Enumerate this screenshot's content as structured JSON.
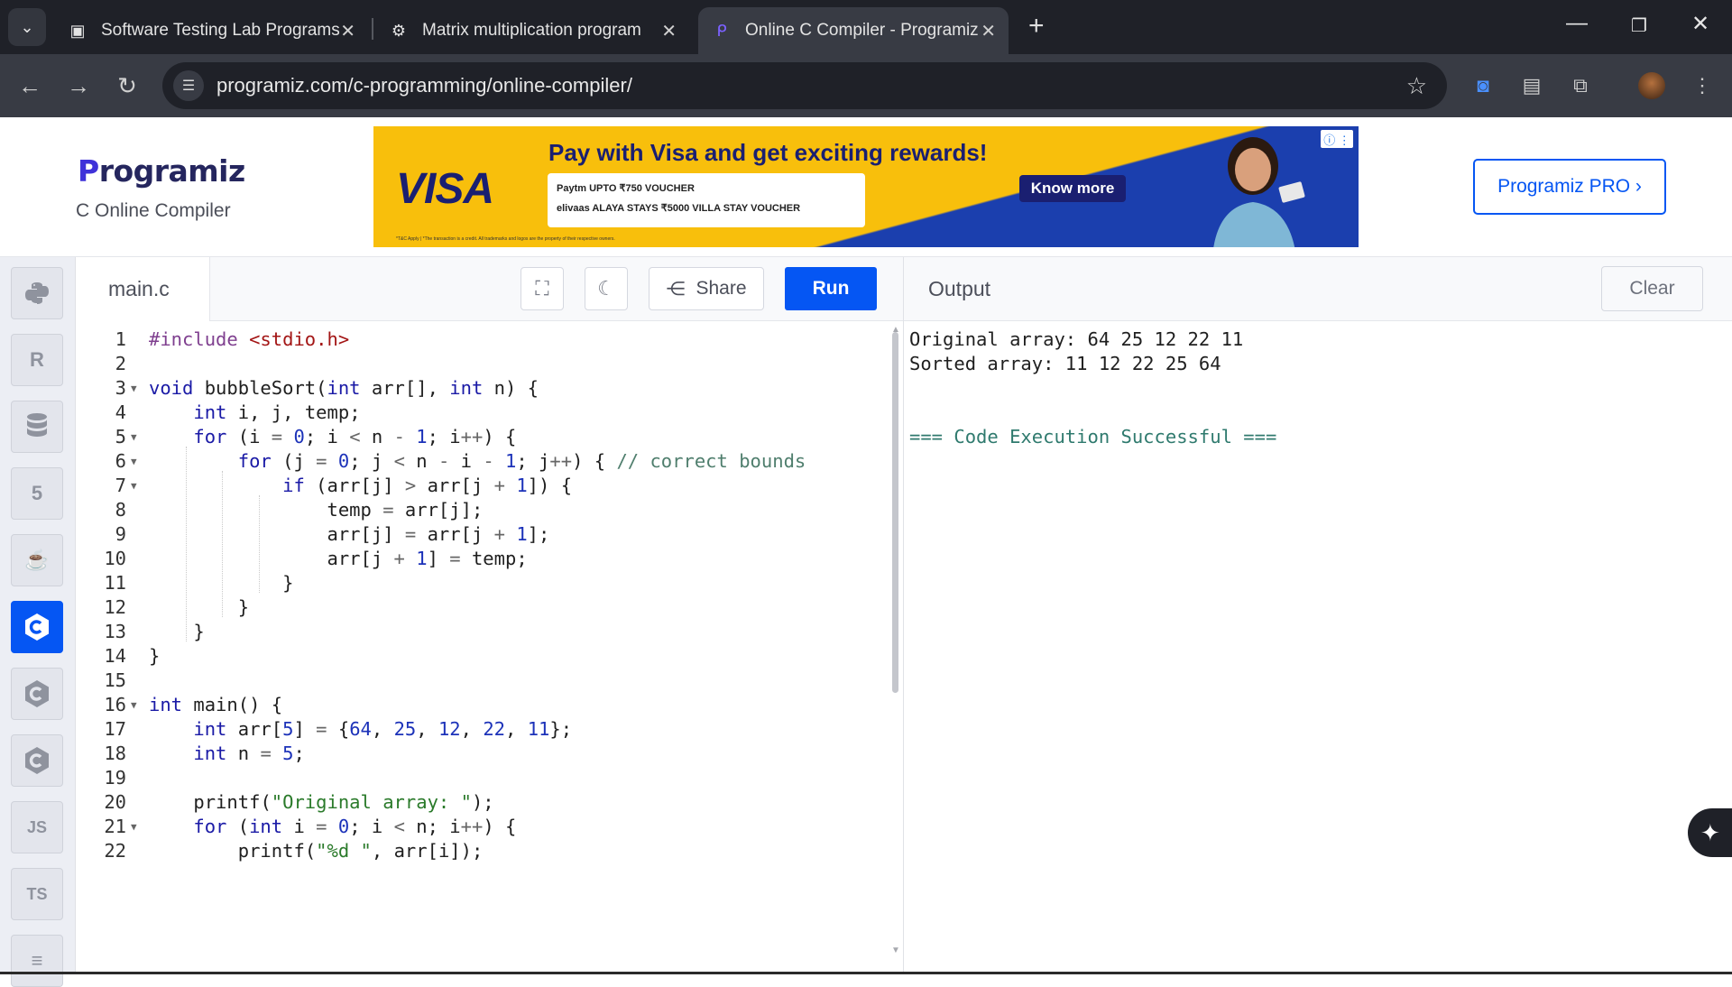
{
  "browser": {
    "tabs": [
      {
        "title": "Software Testing Lab Programs",
        "icon": "classroom-icon"
      },
      {
        "title": "Matrix multiplication program",
        "icon": "chatgpt-icon"
      },
      {
        "title": "Online C Compiler - Programiz",
        "icon": "programiz-icon"
      }
    ],
    "url": "programiz.com/c-programming/online-compiler/"
  },
  "header": {
    "logo": "Programiz",
    "subtitle": "C Online Compiler",
    "pro_button": "Programiz PRO ›",
    "ad": {
      "brand": "VISA",
      "headline": "Pay with Visa and get exciting rewards!",
      "voucher1": "Paytm UPTO ₹750 VOUCHER",
      "voucher2": "elivaas  ALAYA STAYS  ₹5000 VILLA STAY VOUCHER",
      "cta": "Know more",
      "fine_print": "*T&C Apply | *The transaction is a credit. All trademarks and logos are the property of their respective owners."
    }
  },
  "sidebar": {
    "languages": [
      "python",
      "r",
      "sql",
      "html",
      "java",
      "c",
      "cpp",
      "csharp",
      "js",
      "ts",
      "more"
    ],
    "js_label": "JS",
    "ts_label": "TS",
    "active": "c"
  },
  "editor": {
    "filename": "main.c",
    "share_label": "Share",
    "run_label": "Run",
    "lines": [
      "#include <stdio.h>",
      "",
      "void bubbleSort(int arr[], int n) {",
      "    int i, j, temp;",
      "    for (i = 0; i < n - 1; i++) {",
      "        for (j = 0; j < n - i - 1; j++) { // correct bounds",
      "            if (arr[j] > arr[j + 1]) {",
      "                temp = arr[j];",
      "                arr[j] = arr[j + 1];",
      "                arr[j + 1] = temp;",
      "            }",
      "        }",
      "    }",
      "}",
      "",
      "int main() {",
      "    int arr[5] = {64, 25, 12, 22, 11};",
      "    int n = 5;",
      "",
      "    printf(\"Original array: \");",
      "    for (int i = 0; i < n; i++) {",
      "        printf(\"%d \", arr[i]);"
    ],
    "fold_lines": [
      3,
      5,
      6,
      7,
      16,
      21
    ]
  },
  "output": {
    "title": "Output",
    "clear_label": "Clear",
    "lines": [
      "Original array: 64 25 12 22 11",
      "Sorted array: 11 12 22 25 64",
      "",
      "",
      "=== Code Execution Successful ==="
    ]
  }
}
